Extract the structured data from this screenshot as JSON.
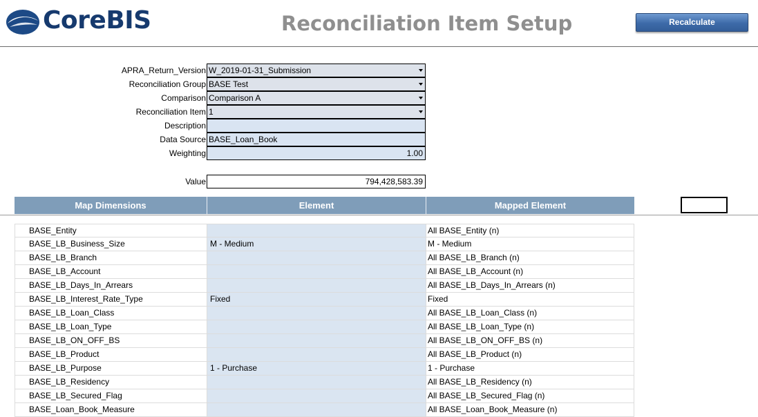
{
  "header": {
    "logo_text": "CoreBIS",
    "page_title": "Reconciliation Item Setup",
    "recalculate_label": "Recalculate"
  },
  "form": {
    "apra_return_version": {
      "label": "APRA_Return_Version",
      "value": "W_2019-01-31_Submission"
    },
    "reconciliation_group": {
      "label": "Reconciliation Group",
      "value": "BASE Test"
    },
    "comparison": {
      "label": "Comparison",
      "value": "Comparison A"
    },
    "reconciliation_item": {
      "label": "Reconciliation Item",
      "value": "1"
    },
    "description": {
      "label": "Description",
      "value": ""
    },
    "data_source": {
      "label": "Data Source",
      "value": "BASE_Loan_Book"
    },
    "weighting": {
      "label": "Weighting",
      "value": "1.00"
    },
    "value": {
      "label": "Value",
      "value": "794,428,583.39"
    }
  },
  "table": {
    "headers": [
      "Map Dimensions",
      "Element",
      "Mapped Element"
    ],
    "rows": [
      {
        "dimension": "BASE_Entity",
        "element": "",
        "mapped": "All BASE_Entity (n)"
      },
      {
        "dimension": "BASE_LB_Business_Size",
        "element": "M - Medium",
        "mapped": "M - Medium"
      },
      {
        "dimension": "BASE_LB_Branch",
        "element": "",
        "mapped": "All BASE_LB_Branch (n)"
      },
      {
        "dimension": "BASE_LB_Account",
        "element": "",
        "mapped": "All BASE_LB_Account (n)"
      },
      {
        "dimension": "BASE_LB_Days_In_Arrears",
        "element": "",
        "mapped": "All BASE_LB_Days_In_Arrears (n)"
      },
      {
        "dimension": "BASE_LB_Interest_Rate_Type",
        "element": "Fixed",
        "mapped": "Fixed"
      },
      {
        "dimension": "BASE_LB_Loan_Class",
        "element": "",
        "mapped": "All BASE_LB_Loan_Class (n)"
      },
      {
        "dimension": "BASE_LB_Loan_Type",
        "element": "",
        "mapped": "All BASE_LB_Loan_Type (n)"
      },
      {
        "dimension": "BASE_LB_ON_OFF_BS",
        "element": "",
        "mapped": "All BASE_LB_ON_OFF_BS (n)"
      },
      {
        "dimension": "BASE_LB_Product",
        "element": "",
        "mapped": "All BASE_LB_Product (n)"
      },
      {
        "dimension": "BASE_LB_Purpose",
        "element": "1 - Purchase",
        "mapped": "1 - Purchase"
      },
      {
        "dimension": "BASE_LB_Residency",
        "element": "",
        "mapped": "All BASE_LB_Residency (n)"
      },
      {
        "dimension": "BASE_LB_Secured_Flag",
        "element": "",
        "mapped": "All BASE_LB_Secured_Flag (n)"
      },
      {
        "dimension": "BASE_Loan_Book_Measure",
        "element": "",
        "mapped": "All BASE_Loan_Book_Measure (n)"
      }
    ]
  },
  "colors": {
    "brand": "#163a6e",
    "header_bg": "#7f9db9",
    "input_bg": "#d9e4f2",
    "button": "#3d6aa8"
  }
}
